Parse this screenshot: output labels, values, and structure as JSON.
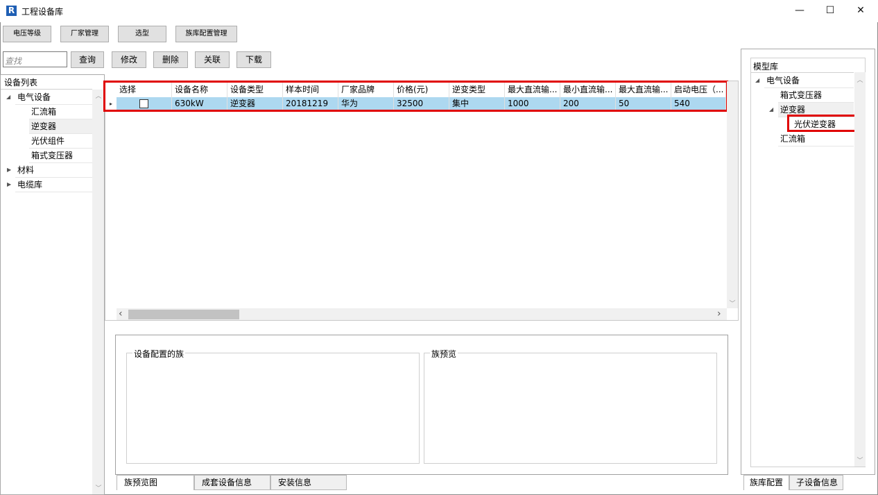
{
  "window": {
    "title": "工程设备库",
    "logo_letter": "R",
    "minimize_glyph": "—",
    "maximize_glyph": "☐",
    "close_glyph": "✕"
  },
  "toolbar1": {
    "voltage_label": "电压等级",
    "vendor_label": "厂家管理",
    "select_label": "选型",
    "family_config_label": "族库配置管理"
  },
  "toolbar2": {
    "search_placeholder": "查找",
    "query_label": "查询",
    "modify_label": "修改",
    "delete_label": "删除",
    "link_label": "关联",
    "download_label": "下载"
  },
  "device_list": {
    "header": "设备列表",
    "items": [
      {
        "label": "电气设备",
        "expanded_glyph": "◢"
      },
      {
        "label": "汇流箱"
      },
      {
        "label": "逆变器"
      },
      {
        "label": "光伏组件"
      },
      {
        "label": "箱式变压器"
      },
      {
        "label": "材料",
        "collapsed_glyph": "▶"
      },
      {
        "label": "电缆库",
        "collapsed_glyph": "▶"
      }
    ]
  },
  "grid": {
    "columns": [
      "选择",
      "设备名称",
      "设备类型",
      "样本时间",
      "厂家品牌",
      "价格(元)",
      "逆变类型",
      "最大直流输...",
      "最小直流输...",
      "最大直流输...",
      "启动电压（..."
    ],
    "rows": [
      {
        "indicator": "▸",
        "checked": false,
        "cells": [
          "630kW",
          "逆变器",
          "20181219",
          "华为",
          "32500",
          "集中",
          "1000",
          "200",
          "50",
          "540"
        ]
      }
    ],
    "scroll_left": "‹",
    "scroll_right": "›",
    "scroll_up": "︿",
    "scroll_down": "﹀"
  },
  "lower": {
    "family_group_label": "设备配置的族",
    "preview_group_label": "族预览",
    "tabs": [
      "族预览图",
      "成套设备信息",
      "安装信息"
    ]
  },
  "model_lib": {
    "header": "模型库",
    "items": [
      {
        "label": "电气设备"
      },
      {
        "label": "箱式变压器"
      },
      {
        "label": "逆变器"
      },
      {
        "label": "光伏逆变器"
      },
      {
        "label": "汇流箱"
      }
    ],
    "tabs": [
      "族库配置",
      "子设备信息"
    ]
  },
  "colors": {
    "selection": "#add8f0",
    "highlight": "#e00000",
    "button_face": "#e1e1e1"
  }
}
